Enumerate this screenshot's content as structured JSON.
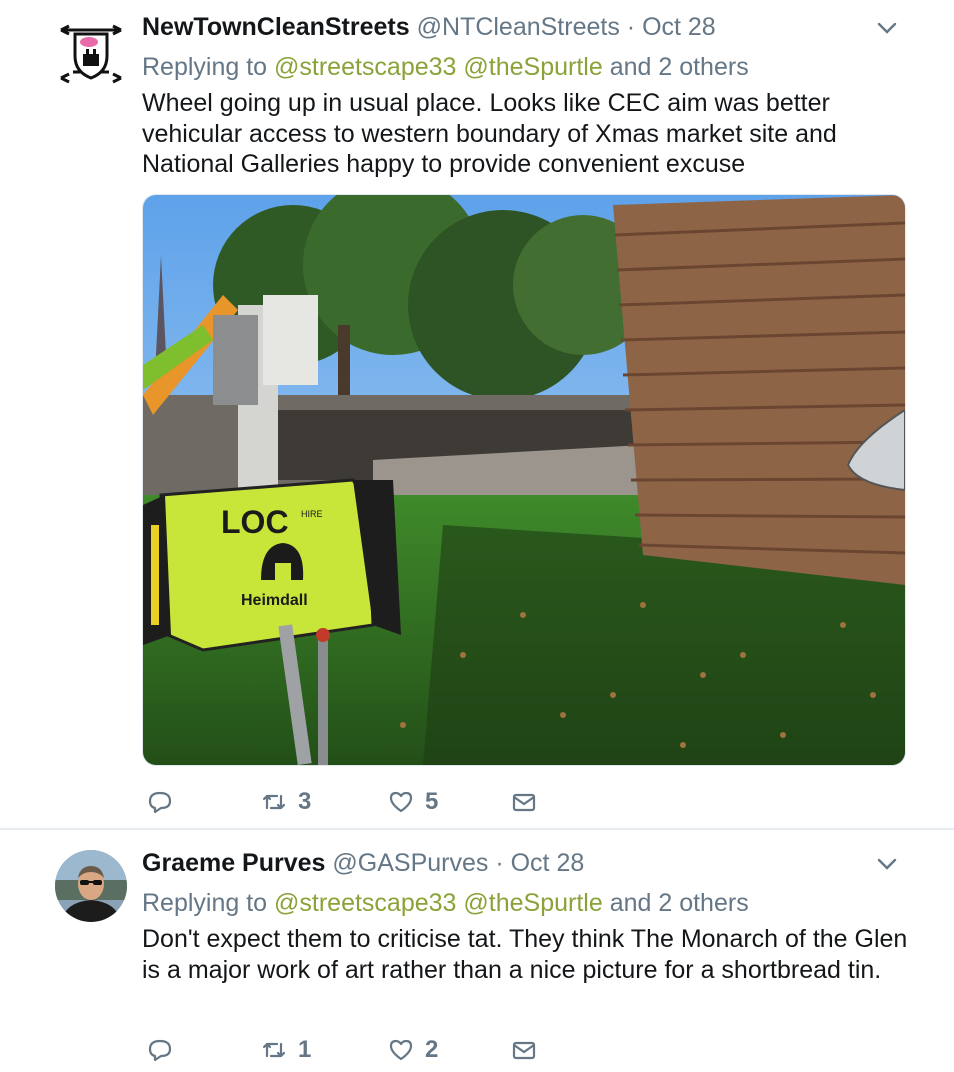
{
  "tweets": [
    {
      "name": "NewTownCleanStreets",
      "handle": "@NTCleanStreets",
      "date": "· Oct 28",
      "replying_prefix": "Replying to",
      "mention_1": "@streetscape33",
      "mention_2": "@theSpurtle",
      "others": "and 2 others",
      "text": "Wheel going up in usual place. Looks like CEC aim was better vehicular access to western boundary of Xmas market site and National Galleries happy to provide convenient excuse",
      "retweets": "3",
      "likes": "5",
      "media": {
        "generator_brand": "LOC",
        "generator_brand_sub": "HIRE",
        "generator_model": "Heimdall"
      }
    },
    {
      "name": "Graeme Purves",
      "handle": "@GASPurves",
      "date": "· Oct 28",
      "replying_prefix": "Replying to",
      "mention_1": "@streetscape33",
      "mention_2": "@theSpurtle",
      "others": "and 2 others",
      "text": "Don't expect them to criticise tat.  They think The Monarch of the Glen is a major work of art rather than a nice picture for a shortbread tin.",
      "retweets": "1",
      "likes": "2"
    }
  ],
  "colors": {
    "mention": "#8aa339",
    "meta": "#657786",
    "divider": "#e6ecf0",
    "generator": "#c8e63a"
  },
  "icons": [
    "chevron-down-icon",
    "reply-icon",
    "retweet-icon",
    "like-icon",
    "dm-icon"
  ]
}
